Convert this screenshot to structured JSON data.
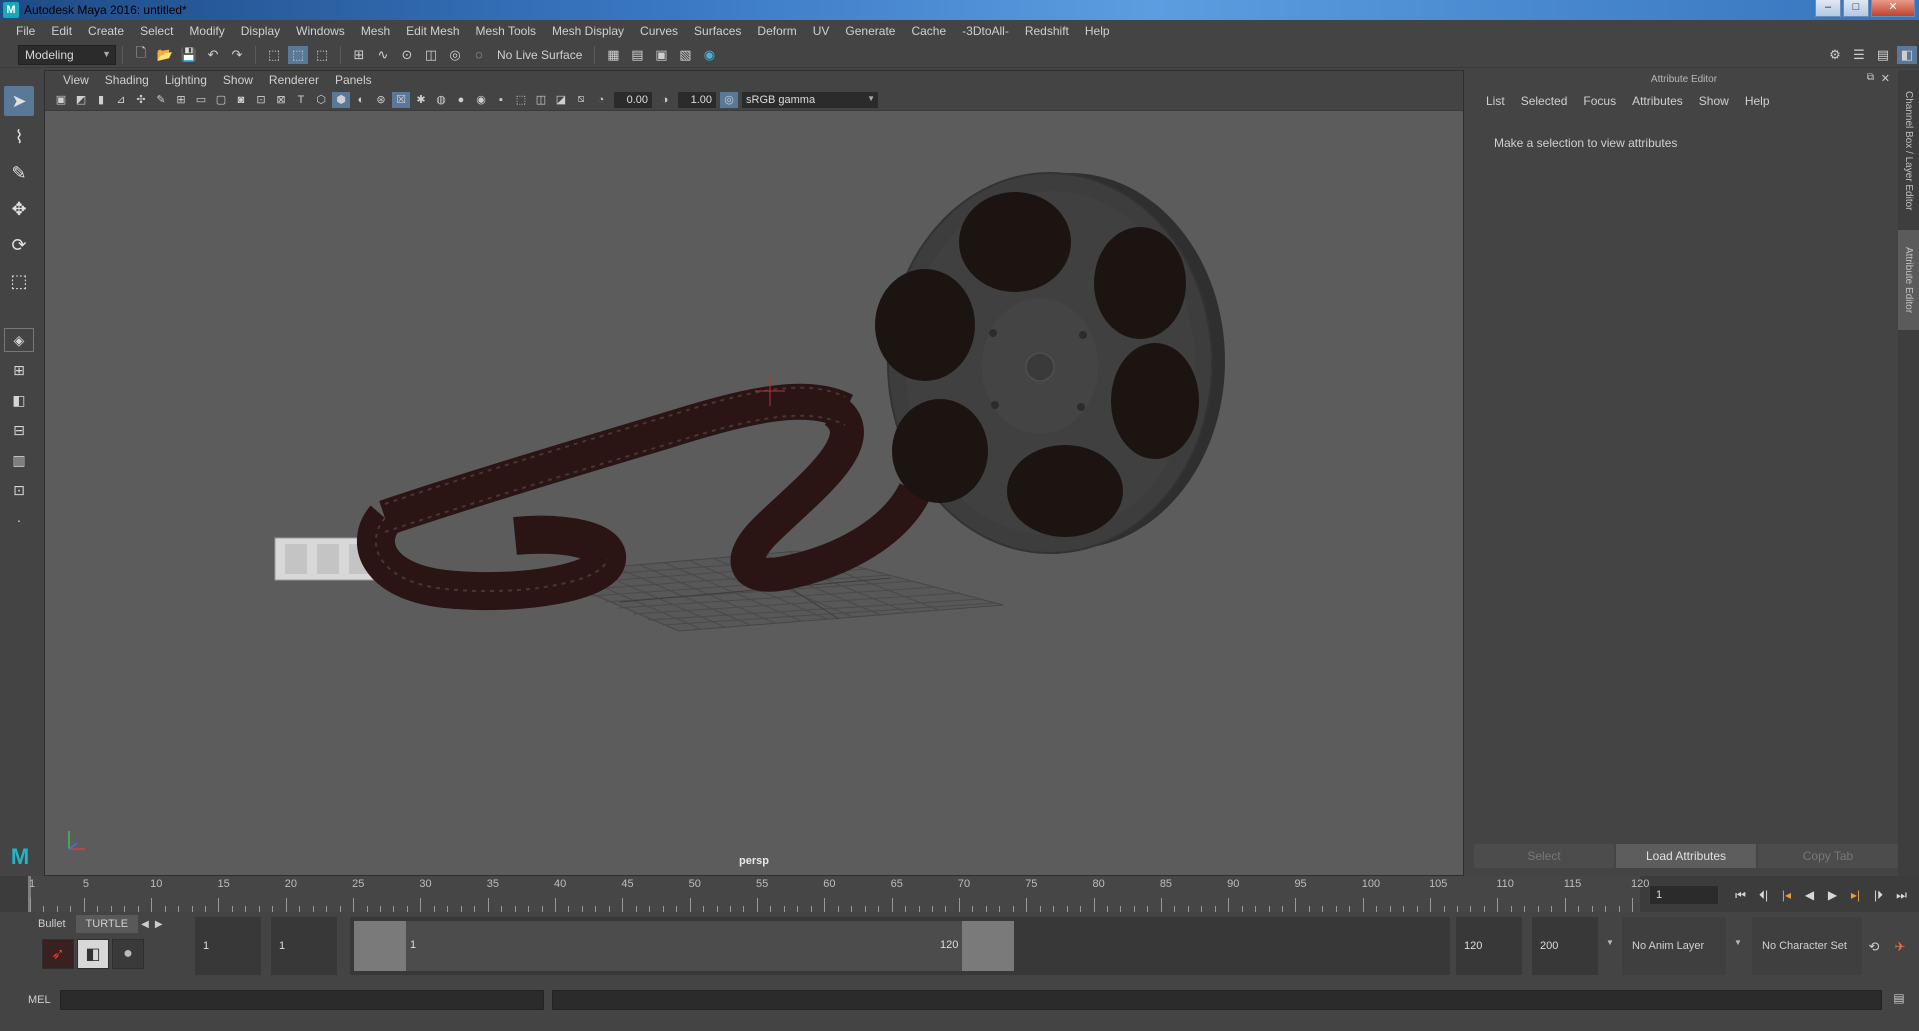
{
  "window": {
    "title": "Autodesk Maya 2016: untitled*"
  },
  "menubar": [
    "File",
    "Edit",
    "Create",
    "Select",
    "Modify",
    "Display",
    "Windows",
    "Mesh",
    "Edit Mesh",
    "Mesh Tools",
    "Mesh Display",
    "Curves",
    "Surfaces",
    "Deform",
    "UV",
    "Generate",
    "Cache",
    "-3DtoAll-",
    "Redshift",
    "Help"
  ],
  "statusline": {
    "mode": "Modeling",
    "live_surface": "No Live Surface"
  },
  "viewport": {
    "menu": [
      "View",
      "Shading",
      "Lighting",
      "Show",
      "Renderer",
      "Panels"
    ],
    "exposure": "0.00",
    "gamma": "1.00",
    "color_space": "sRGB gamma",
    "camera_label": "persp"
  },
  "attribute_editor": {
    "title": "Attribute Editor",
    "menu": [
      "List",
      "Selected",
      "Focus",
      "Attributes",
      "Show",
      "Help"
    ],
    "message": "Make a selection to view attributes",
    "buttons": {
      "select": "Select",
      "load": "Load Attributes",
      "copy_tab": "Copy Tab"
    }
  },
  "side_tabs": {
    "channel_box": "Channel Box / Layer Editor",
    "attribute_editor": "Attribute Editor"
  },
  "timeline": {
    "ticks": [
      "1",
      "5",
      "10",
      "15",
      "20",
      "25",
      "30",
      "35",
      "40",
      "45",
      "50",
      "55",
      "60",
      "65",
      "70",
      "75",
      "80",
      "85",
      "90",
      "95",
      "100",
      "105",
      "110",
      "115",
      "120"
    ],
    "current_frame": "1"
  },
  "range": {
    "start": "1",
    "playback_start": "1",
    "slider_start": "1",
    "slider_end": "120",
    "playback_end": "120",
    "end": "200",
    "anim_layer": "No Anim Layer",
    "character_set": "No Character Set"
  },
  "shelf": {
    "tabs": [
      "Bullet",
      "TURTLE"
    ]
  },
  "command_line": {
    "language": "MEL"
  },
  "colors": {
    "viewport_bg": "#5c5c5c",
    "ui_bg": "#444444",
    "accent": "#5a7897",
    "film": "#2a1414"
  }
}
